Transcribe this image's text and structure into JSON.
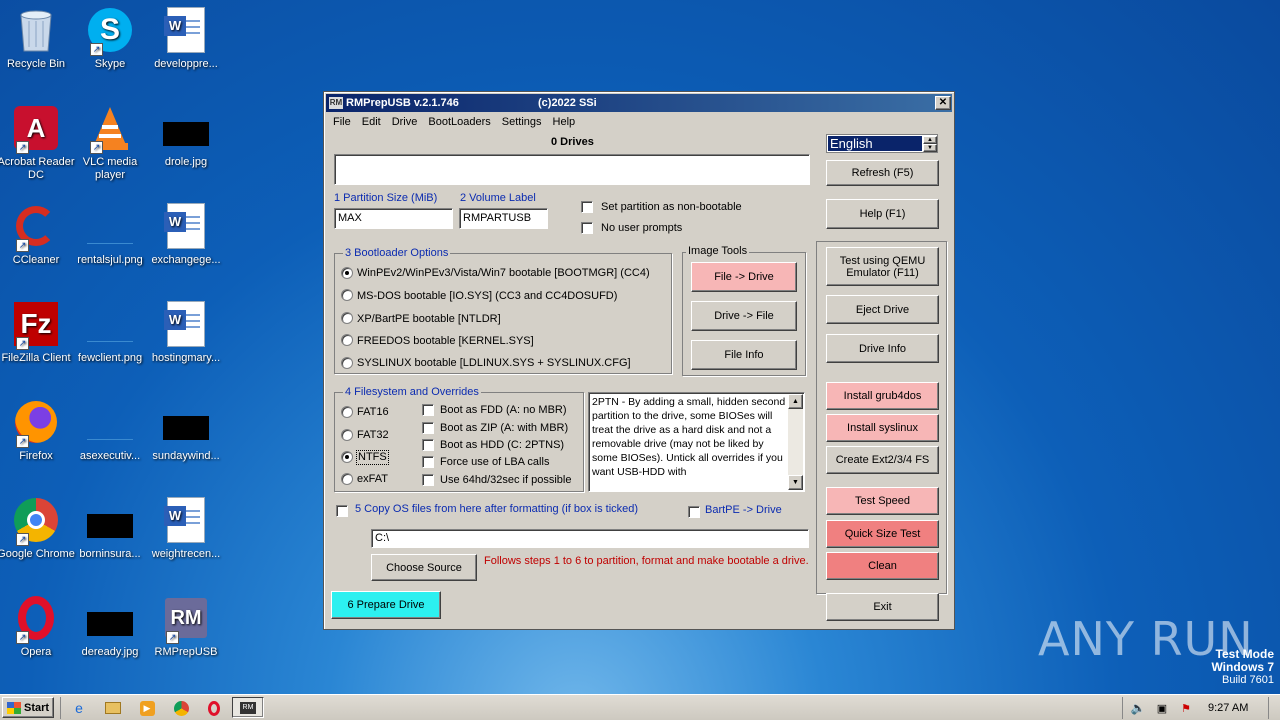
{
  "desktop": {
    "icons": [
      {
        "label": "Recycle Bin"
      },
      {
        "label": "Skype"
      },
      {
        "label": "developpre..."
      },
      {
        "label": "Acrobat Reader DC"
      },
      {
        "label": "VLC media player"
      },
      {
        "label": "drole.jpg"
      },
      {
        "label": "CCleaner"
      },
      {
        "label": "rentalsjul.png"
      },
      {
        "label": "exchangege..."
      },
      {
        "label": "FileZilla Client"
      },
      {
        "label": "fewclient.png"
      },
      {
        "label": "hostingmary..."
      },
      {
        "label": "Firefox"
      },
      {
        "label": "asexecutiv..."
      },
      {
        "label": "sundaywind..."
      },
      {
        "label": "Google Chrome"
      },
      {
        "label": "borninsura..."
      },
      {
        "label": "weightrecen..."
      },
      {
        "label": "Opera"
      },
      {
        "label": "deready.jpg"
      },
      {
        "label": "RMPrepUSB"
      }
    ]
  },
  "window": {
    "title": "RMPrepUSB v.2.1.746",
    "copyright": "(c)2022 SSi",
    "close": "✕",
    "menu": [
      "File",
      "Edit",
      "Drive",
      "BootLoaders",
      "Settings",
      "Help"
    ],
    "drives_label": "0 Drives",
    "language": "English",
    "refresh": "Refresh (F5)",
    "help": "Help (F1)",
    "partition_size_label": "1 Partition Size (MiB)",
    "partition_size_value": "MAX",
    "volume_label_label": "2 Volume Label",
    "volume_label_value": "RMPARTUSB",
    "set_nonbootable": "Set partition as non-bootable",
    "no_prompts": "No user prompts",
    "bootloader_title": "3 Bootloader Options",
    "bootloaders": [
      "WinPEv2/WinPEv3/Vista/Win7 bootable [BOOTMGR] (CC4)",
      "MS-DOS bootable [IO.SYS]    (CC3 and CC4DOSUFD)",
      "XP/BartPE bootable [NTLDR]",
      "FREEDOS bootable [KERNEL.SYS]",
      "SYSLINUX bootable [LDLINUX.SYS + SYSLINUX.CFG]"
    ],
    "image_tools_title": "Image Tools",
    "file_to_drive": "File -> Drive",
    "drive_to_file": "Drive -> File",
    "file_info": "File Info",
    "qemu": "Test using QEMU Emulator (F11)",
    "eject": "Eject Drive",
    "drive_info": "Drive Info",
    "grub4dos": "Install grub4dos",
    "syslinux": "Install syslinux",
    "ext": "Create Ext2/3/4 FS",
    "test_speed": "Test Speed",
    "quick_size": "Quick Size Test",
    "clean": "Clean",
    "exit": "Exit",
    "fs_title": "4 Filesystem and Overrides",
    "filesystems": [
      "FAT16",
      "FAT32",
      "NTFS",
      "exFAT"
    ],
    "overrides": [
      "Boot as FDD (A: no MBR)",
      "Boot as ZIP (A: with MBR)",
      "Boot as HDD (C: 2PTNS)",
      "Force use of LBA calls",
      "Use 64hd/32sec if possible"
    ],
    "help_text": "2PTN - By adding a small, hidden second partition to the drive, some BIOSes will treat the drive as a hard disk and not a removable drive (may not be liked by some BIOSes). Untick all overrides if you want USB-HDD with",
    "copy_os": "5 Copy OS files from here after formatting (if box is ticked)",
    "bartpe": "BartPE -> Drive",
    "source_path": "C:\\",
    "choose_source": "Choose Source",
    "follow_steps": "Follows steps 1 to 6 to partition, format and make bootable a drive.",
    "prepare": "6 Prepare Drive"
  },
  "taskbar": {
    "start": "Start",
    "time": "9:27 AM"
  },
  "watermark": {
    "text": "ANY RUN",
    "test_mode": "Test Mode",
    "os": "Windows 7",
    "build": "Build 7601"
  }
}
